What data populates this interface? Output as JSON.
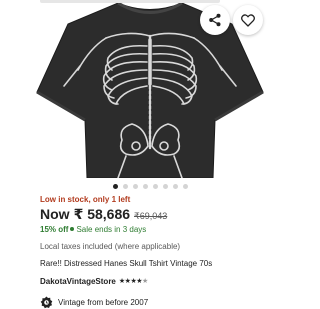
{
  "product": {
    "image_alt": "Black distressed t-shirt with a skeleton print",
    "image_count": 8,
    "active_image": 0,
    "stock_note": "Low in stock, only 1 left",
    "price_label": "Now",
    "price": "₹ 58,686",
    "original_price": "₹69,043",
    "discount": "15% off",
    "sale_note": "Sale ends in 3 days",
    "tax_note": "Local taxes included (where applicable)",
    "title": "Rare!! Distressed Hanes Skull Tshirt Vintage 70s",
    "shop_name": "DakotaVintageStore",
    "rating_stars": 4.5,
    "vintage_note": "Vintage from before 2007"
  },
  "icons": {
    "share": "share-icon",
    "favorite": "heart-icon",
    "vintage": "vintage-badge-icon",
    "star": "star-icon"
  },
  "colors": {
    "stock_warning": "#b23b1e",
    "sale_green": "#2f7d32",
    "text": "#222222",
    "shirt": "#2c2c2c"
  }
}
